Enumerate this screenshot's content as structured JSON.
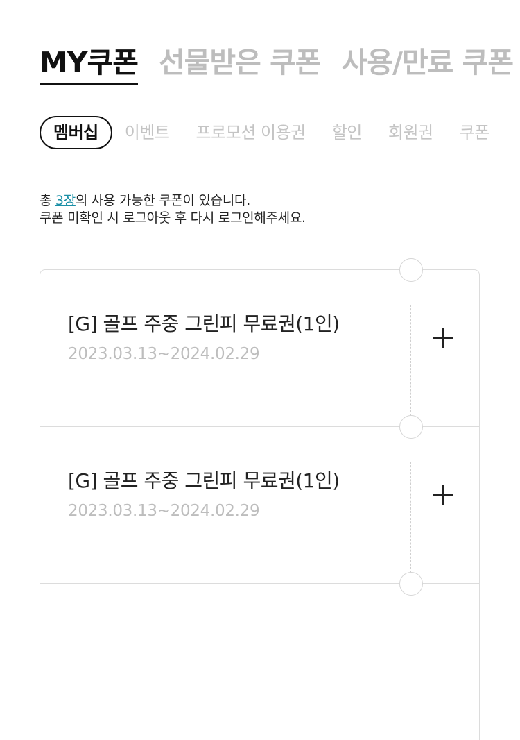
{
  "main_tabs": [
    {
      "label": "MY쿠폰",
      "active": true
    },
    {
      "label": "선물받은 쿠폰",
      "active": false
    },
    {
      "label": "사용/만료 쿠폰",
      "active": false
    }
  ],
  "sub_tabs": [
    {
      "label": "멤버십",
      "active": true
    },
    {
      "label": "이벤트",
      "active": false
    },
    {
      "label": "프로모션 이용권",
      "active": false
    },
    {
      "label": "할인",
      "active": false
    },
    {
      "label": "회원권",
      "active": false
    },
    {
      "label": "쿠폰",
      "active": false
    }
  ],
  "summary": {
    "prefix": "총 ",
    "count": "3장",
    "suffix": "의 사용 가능한 쿠폰이 있습니다.",
    "line2": "쿠폰 미확인 시 로그아웃 후 다시 로그인해주세요."
  },
  "coupons": [
    {
      "title": "[G] 골프 주중 그린피 무료권(1인)",
      "period": "2023.03.13~2024.02.29"
    },
    {
      "title": "[G] 골프 주중 그린피 무료권(1인)",
      "period": "2023.03.13~2024.02.29"
    }
  ],
  "colors": {
    "accent": "#1a8fa6",
    "inactive_tab": "#bdbdbd",
    "period_text": "#bdbdbd",
    "border": "#dcdcdc"
  },
  "icons": {
    "expand": "plus-icon"
  }
}
